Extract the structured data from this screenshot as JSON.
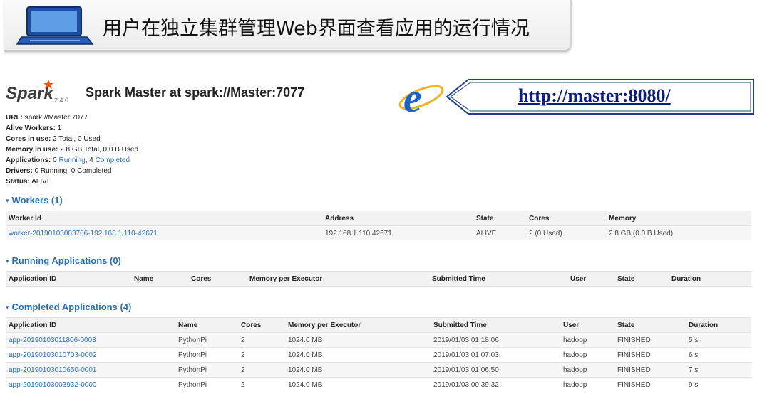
{
  "banner": {
    "title": "用户在独立集群管理Web界面查看应用的运行情况"
  },
  "header": {
    "logo": "Spark",
    "version": "2.4.0",
    "title": "Spark Master at spark://Master:7077"
  },
  "url_callout": "http://master:8080/",
  "info": {
    "url_label": "URL:",
    "url_value": "spark://Master:7077",
    "alive_label": "Alive Workers:",
    "alive_value": "1",
    "cores_label": "Cores in use:",
    "cores_value": "2 Total, 0 Used",
    "memory_label": "Memory in use:",
    "memory_value": "2.8 GB Total, 0.0 B Used",
    "apps_label": "Applications:",
    "apps_prefix": "0",
    "apps_running": "Running",
    "apps_sep": ", 4",
    "apps_completed": "Completed",
    "drivers_label": "Drivers:",
    "drivers_value": "0 Running, 0 Completed",
    "status_label": "Status:",
    "status_value": "ALIVE"
  },
  "workers": {
    "title": "Workers (1)",
    "headers": [
      "Worker Id",
      "Address",
      "State",
      "Cores",
      "Memory"
    ],
    "rows": [
      [
        "worker-20190103003706-192.168.1.110-42671",
        "192.168.1.110:42671",
        "ALIVE",
        "2 (0 Used)",
        "2.8 GB (0.0 B Used)"
      ]
    ]
  },
  "running": {
    "title": "Running Applications (0)",
    "headers": [
      "Application ID",
      "Name",
      "Cores",
      "Memory per Executor",
      "Submitted Time",
      "User",
      "State",
      "Duration"
    ]
  },
  "completed": {
    "title": "Completed Applications (4)",
    "headers": [
      "Application ID",
      "Name",
      "Cores",
      "Memory per Executor",
      "Submitted Time",
      "User",
      "State",
      "Duration"
    ],
    "rows": [
      [
        "app-20190103011806-0003",
        "PythonPi",
        "2",
        "1024.0 MB",
        "2019/01/03 01:18:06",
        "hadoop",
        "FINISHED",
        "5 s"
      ],
      [
        "app-20190103010703-0002",
        "PythonPi",
        "2",
        "1024.0 MB",
        "2019/01/03 01:07:03",
        "hadoop",
        "FINISHED",
        "6 s"
      ],
      [
        "app-20190103010650-0001",
        "PythonPi",
        "2",
        "1024.0 MB",
        "2019/01/03 01:06:50",
        "hadoop",
        "FINISHED",
        "7 s"
      ],
      [
        "app-20190103003932-0000",
        "PythonPi",
        "2",
        "1024.0 MB",
        "2019/01/03 00:39:32",
        "hadoop",
        "FINISHED",
        "9 s"
      ]
    ]
  },
  "colors": {
    "link": "#2a6fb5",
    "url_text": "#0b1f7a",
    "ie_blue": "#1d62c9"
  }
}
